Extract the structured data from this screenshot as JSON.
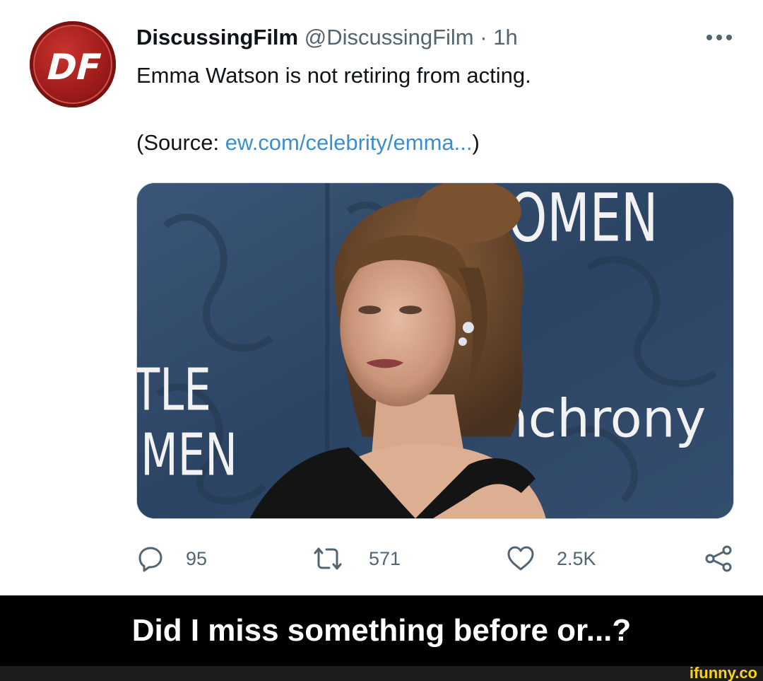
{
  "tweet": {
    "display_name": "DiscussingFilm",
    "handle": "@DiscussingFilm",
    "separator": "·",
    "time": "1h",
    "text": "Emma Watson is not retiring from acting.",
    "source_prefix": "(Source: ",
    "source_link": "ew.com/celebrity/emma...",
    "source_suffix": ")",
    "avatar_logo": "DF"
  },
  "media": {
    "backdrop_top": "OMEN",
    "backdrop_left_1": "TLE",
    "backdrop_left_2": "MEN",
    "backdrop_right": "nchrony"
  },
  "actions": {
    "reply_count": "95",
    "retweet_count": "571",
    "like_count": "2.5K"
  },
  "caption": "Did I miss something before or...?",
  "watermark": "ifunny.co",
  "colors": {
    "accent_link": "#3a8fd0",
    "muted": "#536471",
    "avatar_red": "#b02420",
    "caption_bg": "#000000",
    "watermark": "#f5d21b"
  },
  "icons": [
    "more-icon",
    "reply-icon",
    "retweet-icon",
    "like-icon",
    "share-icon"
  ]
}
